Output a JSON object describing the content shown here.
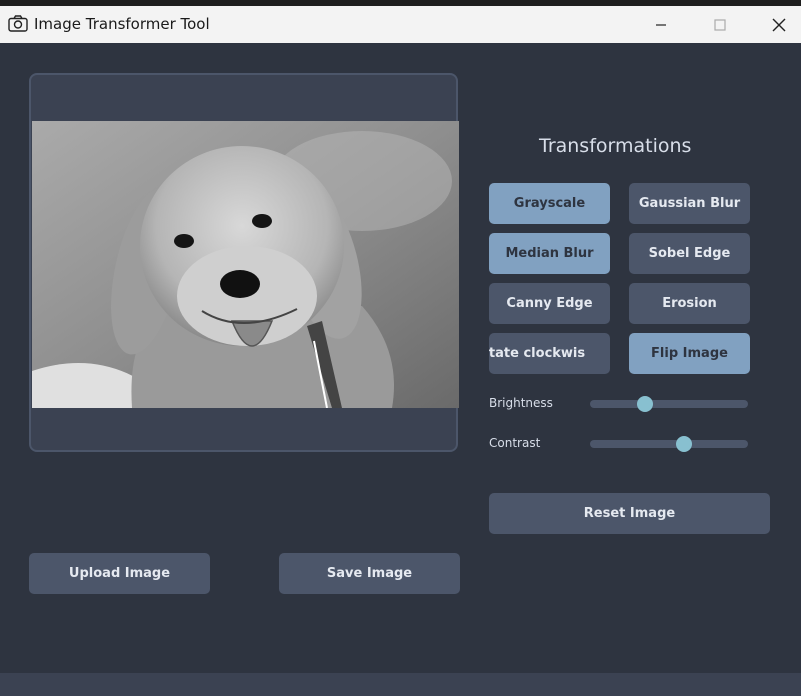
{
  "window": {
    "title": "Image Transformer Tool",
    "app_icon": "camera-icon",
    "controls": [
      "minimize-icon",
      "maximize-icon",
      "close-icon"
    ]
  },
  "transformations": {
    "heading": "Transformations",
    "buttons": [
      {
        "label": "Grayscale",
        "active": true
      },
      {
        "label": "Gaussian Blur",
        "active": false
      },
      {
        "label": "Median Blur",
        "active": true
      },
      {
        "label": "Sobel Edge",
        "active": false
      },
      {
        "label": "Canny Edge",
        "active": false
      },
      {
        "label": "Erosion",
        "active": false
      },
      {
        "label": "Rotate clockwise",
        "visible_text": "otate clockwis",
        "active": false
      },
      {
        "label": "Flip Image",
        "active": true
      }
    ]
  },
  "sliders": {
    "brightness": {
      "label": "Brightness",
      "value": 0.35
    },
    "contrast": {
      "label": "Contrast",
      "value": 0.6
    }
  },
  "actions": {
    "reset": "Reset Image",
    "upload": "Upload Image",
    "save": "Save Image"
  },
  "image": {
    "subject": "grayscale puppy photo"
  },
  "colors": {
    "background": "#2e3440",
    "panel": "#3b4252",
    "button": "#4c566a",
    "button_active": "#81a1c1",
    "slider_knob": "#88c0d0"
  }
}
